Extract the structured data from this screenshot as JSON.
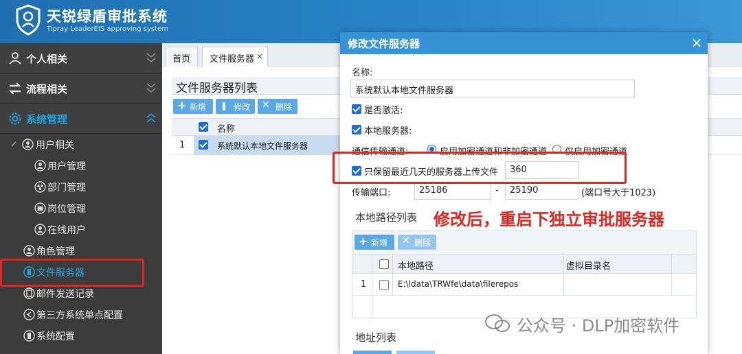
{
  "app": {
    "title": "天锐绿盾审批系统",
    "subtitle": "Tipray LeaderEIS approving system"
  },
  "sidebar": {
    "sections": [
      {
        "label": "个人相关"
      },
      {
        "label": "流程相关"
      },
      {
        "label": "系统管理"
      }
    ],
    "tree": {
      "group": "用户相关",
      "children": [
        "用户管理",
        "部门管理",
        "岗位管理",
        "在线用户"
      ],
      "items": [
        "角色管理",
        "文件服务器",
        "邮件发送记录",
        "第三方系统单点配置",
        "系统配置"
      ]
    }
  },
  "tabs": [
    {
      "label": "首页"
    },
    {
      "label": "文件服务器",
      "close": "×"
    }
  ],
  "list": {
    "title": "文件服务器列表",
    "buttons": {
      "add": "新增",
      "edit": "修改",
      "delete": "删除"
    },
    "columns": {
      "name": "名称"
    },
    "rows": [
      {
        "index": "1",
        "name": "系统默认本地文件服务器"
      }
    ]
  },
  "modal": {
    "title": "修改文件服务器",
    "close": "×",
    "name_label": "名称:",
    "name_value": "系统默认本地文件服务器",
    "active_label": "是否激活:",
    "local_label": "本地服务器:",
    "channel_label": "通信传输通道:",
    "channel_opt1": "启用加密通道和非加密通道",
    "channel_opt2": "仅启用加密通道",
    "keep_label": "只保留最近几天的服务器上传文件",
    "keep_value": "360",
    "port_label": "传输端口:",
    "port_from": "25186",
    "port_sep": "-",
    "port_to": "25190",
    "port_hint": "(端口号大于1023)",
    "local_paths_title": "本地路径列表",
    "sub_buttons": {
      "add": "新增",
      "delete": "删除"
    },
    "sub_columns": {
      "path": "本地路径",
      "virtual": "虚拟目录名"
    },
    "sub_rows": [
      {
        "index": "1",
        "path": "E:\\ldata\\TRWfe\\data\\filerepos",
        "virtual": ""
      }
    ],
    "address_title": "地址列表"
  },
  "annotation": "修改后，重启下独立审批服务器",
  "watermark": "公众号 · DLP加密软件",
  "colors": {
    "header": "#2a86c9",
    "sidebar": "#3b3b3b",
    "accent": "#1fa3e0",
    "annotation": "#e0271f",
    "modal_header": "#3594d6"
  }
}
